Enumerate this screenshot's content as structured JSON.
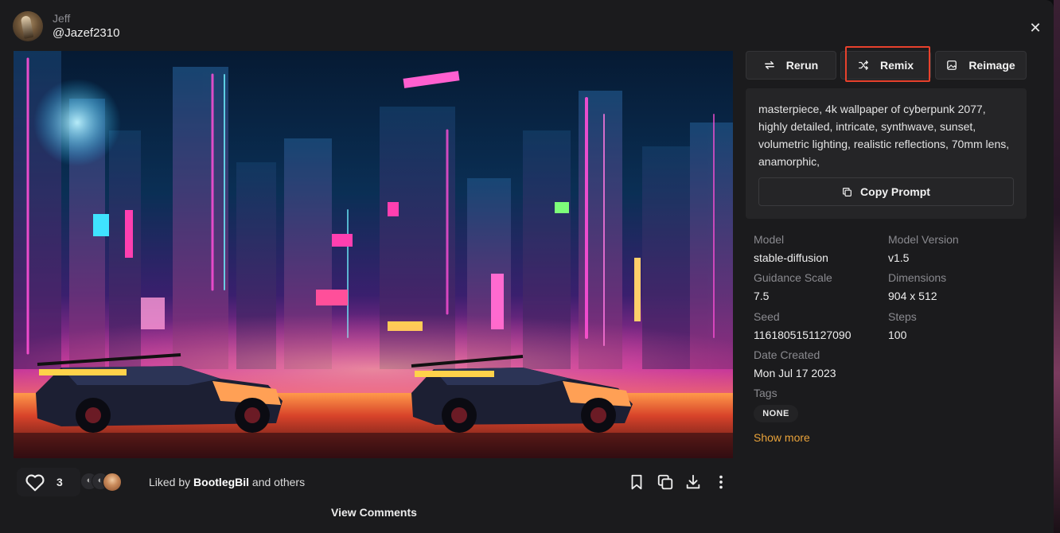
{
  "user": {
    "name": "Jeff",
    "handle": "@Jazef2310"
  },
  "actions": {
    "rerun": "Rerun",
    "remix": "Remix",
    "reimage": "Reimage",
    "copy_prompt": "Copy Prompt"
  },
  "prompt": "masterpiece, 4k wallpaper of cyberpunk 2077, highly detailed, intricate, synthwave, sunset, volumetric lighting, realistic reflections, 70mm lens, anamorphic,",
  "meta": {
    "model_label": "Model",
    "model": "stable-diffusion",
    "version_label": "Model Version",
    "version": "v1.5",
    "guidance_label": "Guidance Scale",
    "guidance": "7.5",
    "dimensions_label": "Dimensions",
    "dimensions": "904 x 512",
    "seed_label": "Seed",
    "seed": "1161805151127090",
    "steps_label": "Steps",
    "steps": "100",
    "date_label": "Date Created",
    "date": "Mon Jul 17 2023",
    "tags_label": "Tags",
    "tag": "NONE"
  },
  "show_more": "Show more",
  "likes": {
    "count": "3",
    "prefix": "Liked by ",
    "user": "BootlegBil",
    "suffix": " and others"
  },
  "view_comments": "View Comments",
  "icons": {
    "close": "close-icon",
    "rerun": "repeat-icon",
    "remix": "shuffle-icon",
    "reimage": "image-icon",
    "copy": "copy-icon",
    "heart": "heart-icon",
    "bookmark": "bookmark-icon",
    "duplicate": "duplicate-icon",
    "download": "download-icon",
    "more": "more-vertical-icon"
  },
  "colors": {
    "accent_orange": "#e8a23a",
    "highlight_red": "#e8412c",
    "panel": "#252527"
  }
}
